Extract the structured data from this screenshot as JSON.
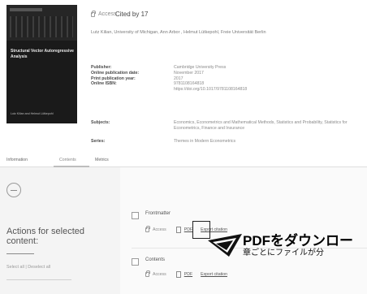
{
  "book": {
    "cover_title": "Structural Vector Autoregressive Analysis",
    "cover_authors": "Lutz Kilian and Helmut Lütkepohl"
  },
  "header": {
    "access_label": "Access",
    "cited_by": "Cited by 17",
    "authors_line": "Lutz Kilian, University of Michigan, Ann Arbor , Helmut Lütkepohl, Freie Universität Berlin"
  },
  "details": {
    "publisher_label": "Publisher:",
    "publisher_value": "Cambridge University Press",
    "online_date_label": "Online publication date:",
    "online_date_value": "November 2017",
    "print_year_label": "Print publication year:",
    "print_year_value": "2017",
    "isbn_label": "Online ISBN:",
    "isbn_value": "9781108164818",
    "doi_value": "https://doi.org/10.1017/9781108164818",
    "subjects_label": "Subjects:",
    "subjects_value": "Economics, Econometrics and Mathematical Methods, Statistics and Probability, Statistics for Econometrics, Finance and Insurance",
    "series_label": "Series:",
    "series_value": "Themes in Modern Econometrics"
  },
  "tabs": [
    {
      "label": "Information"
    },
    {
      "label": "Contents"
    },
    {
      "label": "Metrics"
    }
  ],
  "sidebar": {
    "actions_title": "Actions for selected content:",
    "select_all": "Select all",
    "separator": "|",
    "deselect_all": "Deselect all"
  },
  "items": [
    {
      "title": "Frontmatter",
      "access": "Access",
      "pdf": "PDF",
      "export": "Export citation"
    },
    {
      "title": "Contents",
      "access": "Access",
      "pdf": "PDF",
      "export": "Export citation"
    }
  ],
  "callout": {
    "title": "PDFをダウンロー",
    "subtitle": "章ごとにファイルが分"
  }
}
